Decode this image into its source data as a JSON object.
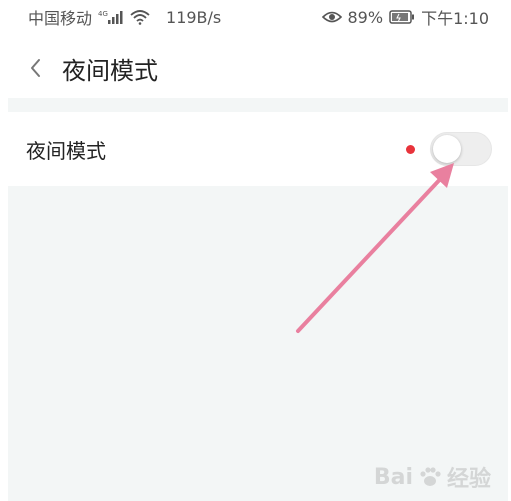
{
  "status_bar": {
    "carrier": "中国移动",
    "signal_label": "4G",
    "net_speed": "119B/s",
    "battery": "89%",
    "time": "下午1:10",
    "icons": [
      "signal-icon",
      "wifi-icon",
      "eye-icon",
      "battery-icon"
    ]
  },
  "header": {
    "back_icon": "chevron-left-icon",
    "title": "夜间模式"
  },
  "settings": {
    "night_mode": {
      "label": "夜间模式",
      "enabled": false,
      "has_new_dot": true
    }
  },
  "colors": {
    "content_bg": "#f3f6f6",
    "red_dot": "#e8333b",
    "arrow": "#e9809f",
    "toggle_off": "#eeeeee"
  },
  "watermark": {
    "text": "Bai",
    "suffix": "经验"
  }
}
